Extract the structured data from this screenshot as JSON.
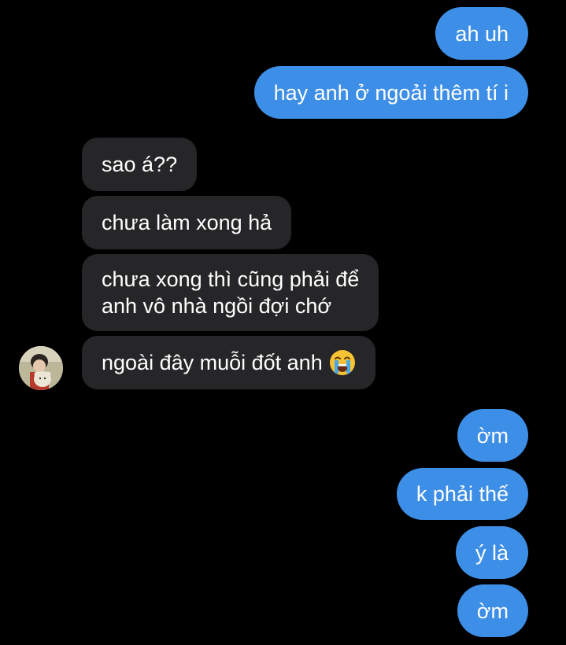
{
  "conversation": {
    "messages": [
      {
        "sender": "me",
        "text": "ah uh"
      },
      {
        "sender": "me",
        "text": "hay anh ở ngoải thêm tí i"
      },
      {
        "sender": "them",
        "text": "sao á??"
      },
      {
        "sender": "them",
        "text": "chưa làm xong hả"
      },
      {
        "sender": "them",
        "line1": "chưa xong thì cũng phải để",
        "line2": "anh vô nhà ngồi đợi chớ"
      },
      {
        "sender": "them",
        "text": "ngoài đây muỗi đốt anh",
        "emoji": "loudly-crying-face-icon"
      },
      {
        "sender": "me",
        "text": "ờm"
      },
      {
        "sender": "me",
        "text": "k phải thế"
      },
      {
        "sender": "me",
        "text": "ý là"
      },
      {
        "sender": "me",
        "text": "ờm"
      }
    ]
  },
  "colors": {
    "background": "#000000",
    "sent_bubble": "#3d8ee6",
    "received_bubble": "#262628",
    "text": "#ffffff"
  }
}
